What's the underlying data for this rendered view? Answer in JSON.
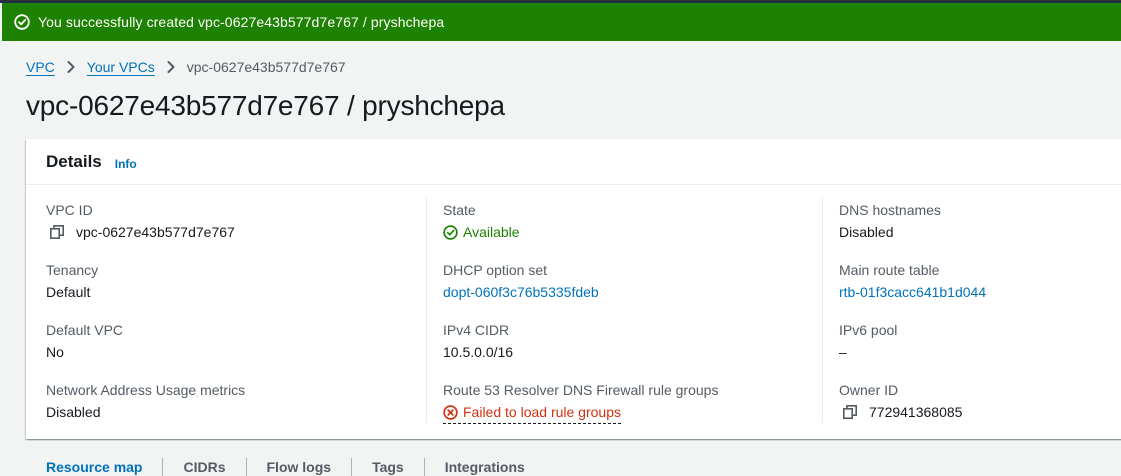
{
  "flash": {
    "message": "You successfully created vpc-0627e43b577d7e767 / pryshchepa",
    "icon": "check-circle-icon"
  },
  "breadcrumb": {
    "items": [
      "VPC",
      "Your VPCs"
    ],
    "current": "vpc-0627e43b577d7e767"
  },
  "page_title": "vpc-0627e43b577d7e767 / pryshchepa",
  "details": {
    "title": "Details",
    "info_label": "Info",
    "vpc_id_label": "VPC ID",
    "vpc_id_value": "vpc-0627e43b577d7e767",
    "tenancy_label": "Tenancy",
    "tenancy_value": "Default",
    "default_vpc_label": "Default VPC",
    "default_vpc_value": "No",
    "nau_label": "Network Address Usage metrics",
    "nau_value": "Disabled",
    "state_label": "State",
    "state_value": "Available",
    "dhcp_label": "DHCP option set",
    "dhcp_value": "dopt-060f3c76b5335fdeb",
    "ipv4_label": "IPv4 CIDR",
    "ipv4_value": "10.5.0.0/16",
    "r53_label": "Route 53 Resolver DNS Firewall rule groups",
    "r53_value": "Failed to load rule groups",
    "dns_hostnames_label": "DNS hostnames",
    "dns_hostnames_value": "Disabled",
    "main_route_label": "Main route table",
    "main_route_value": "rtb-01f3cacc641b1d044",
    "ipv6_pool_label": "IPv6 pool",
    "ipv6_pool_value": "–",
    "owner_label": "Owner ID",
    "owner_value": "772941368085"
  },
  "tabs": [
    "Resource map",
    "CIDRs",
    "Flow logs",
    "Tags",
    "Integrations"
  ],
  "colors": {
    "success": "#1d8102",
    "link": "#0073bb",
    "error": "#d13212",
    "text": "#16191f",
    "label": "#545b64"
  }
}
